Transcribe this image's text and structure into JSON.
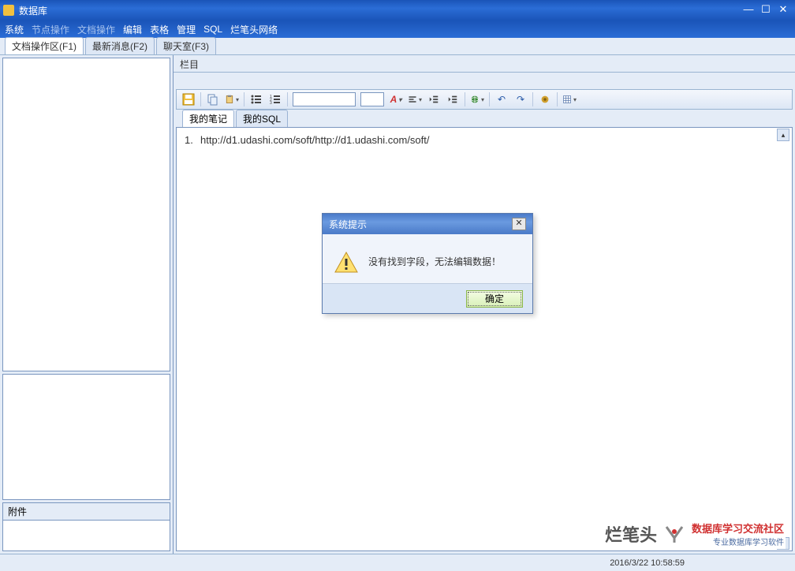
{
  "titlebar": {
    "title": "数据库"
  },
  "menu": {
    "system": "系统",
    "nodeop": "节点操作",
    "docop": "文档操作",
    "edit": "编辑",
    "table": "表格",
    "manage": "管理",
    "sql": "SQL",
    "network": "烂笔头网络"
  },
  "tabs": {
    "doc": "文档操作区(F1)",
    "news": "最新消息(F2)",
    "chat": "聊天室(F3)"
  },
  "left": {
    "attach_label": "附件"
  },
  "right": {
    "section": "栏目",
    "innertabs": {
      "notes": "我的笔记",
      "sql": "我的SQL"
    },
    "content_line1": "http://d1.udashi.com/soft/http://d1.udashi.com/soft/"
  },
  "dialog": {
    "title": "系统提示",
    "message": "没有找到字段，无法编辑数据！",
    "ok": "确定"
  },
  "status": {
    "datetime": "2016/3/22 10:58:59"
  },
  "logo": {
    "brand": "烂笔头",
    "red": "数据库学习交流社区",
    "sub": "专业数据库学习软件"
  }
}
